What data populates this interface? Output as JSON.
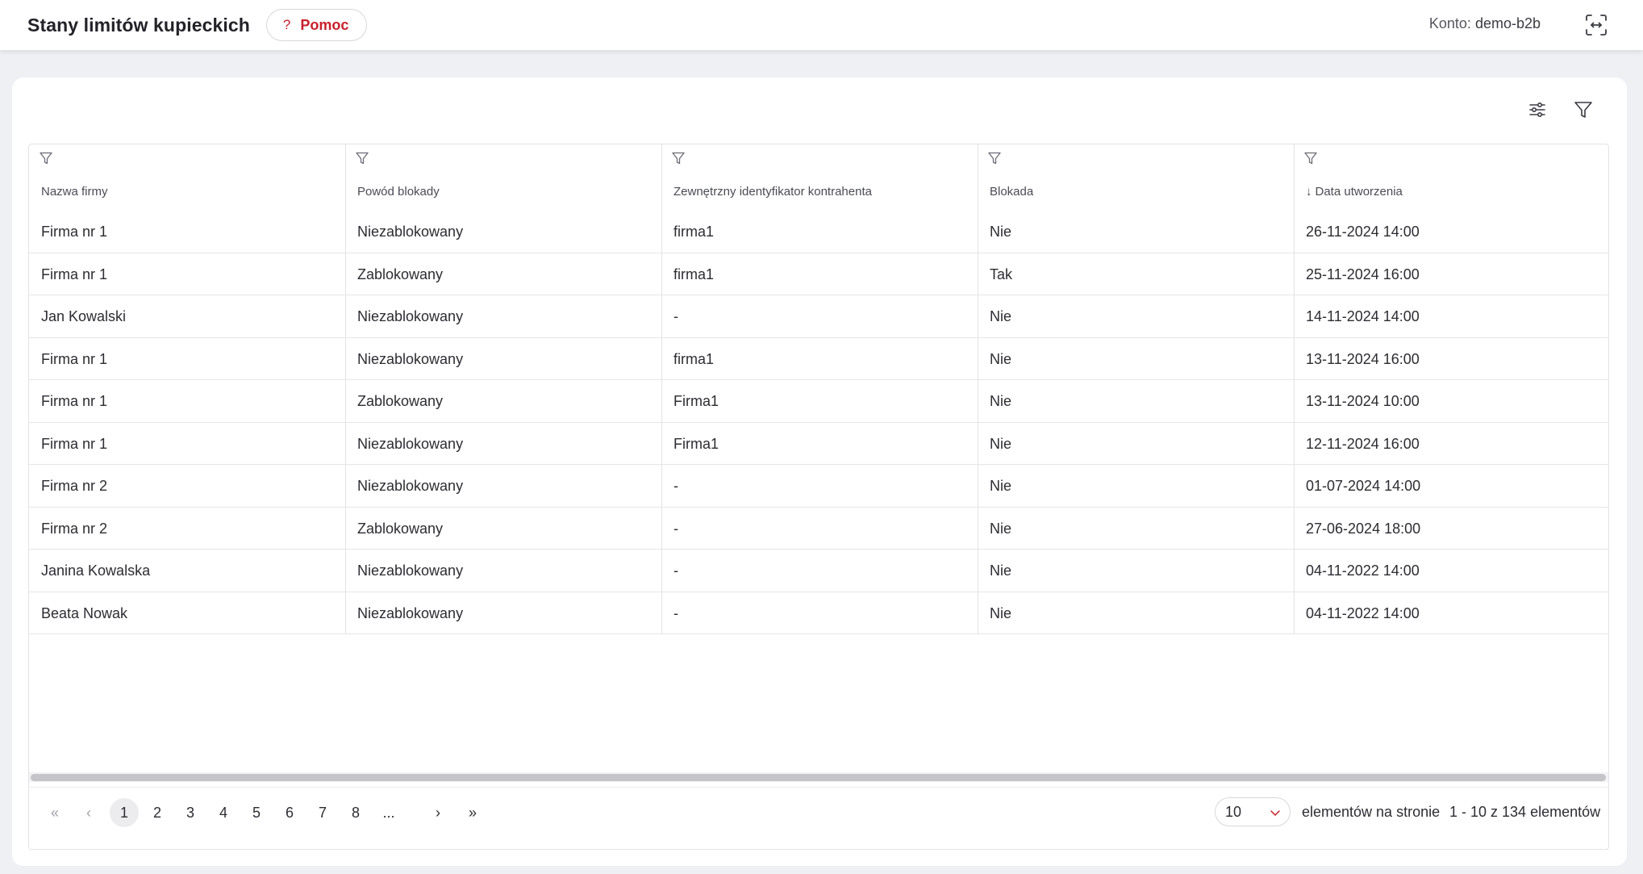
{
  "header": {
    "title": "Stany limitów kupieckich",
    "help_icon": "question-icon",
    "help_label": "Pomoc",
    "account_label": "Konto:",
    "account_value": "demo-b2b",
    "fullscreen_icon": "fullscreen-icon"
  },
  "toolbar": {
    "settings_icon": "sliders-icon",
    "filter_icon": "filter-icon"
  },
  "table": {
    "columns": [
      {
        "label": "Nazwa firmy",
        "sorted": false
      },
      {
        "label": "Powód blokady",
        "sorted": false
      },
      {
        "label": "Zewnętrzny identyfikator kontrahenta",
        "sorted": false
      },
      {
        "label": "Blokada",
        "sorted": false
      },
      {
        "label": "Data utworzenia",
        "sorted": true,
        "sort_direction": "desc",
        "sort_icon": "↓"
      }
    ],
    "rows": [
      [
        "Firma nr 1",
        "Niezablokowany",
        "firma1",
        "Nie",
        "26-11-2024 14:00"
      ],
      [
        "Firma nr 1",
        "Zablokowany",
        "firma1",
        "Tak",
        "25-11-2024 16:00"
      ],
      [
        "Jan Kowalski",
        "Niezablokowany",
        "-",
        "Nie",
        "14-11-2024 14:00"
      ],
      [
        "Firma nr 1",
        "Niezablokowany",
        "firma1",
        "Nie",
        "13-11-2024 16:00"
      ],
      [
        "Firma nr 1",
        "Zablokowany",
        "Firma1",
        "Nie",
        "13-11-2024 10:00"
      ],
      [
        "Firma nr 1",
        "Niezablokowany",
        "Firma1",
        "Nie",
        "12-11-2024 16:00"
      ],
      [
        "Firma nr 2",
        "Niezablokowany",
        "-",
        "Nie",
        "01-07-2024 14:00"
      ],
      [
        "Firma nr 2",
        "Zablokowany",
        "-",
        "Nie",
        "27-06-2024 18:00"
      ],
      [
        "Janina Kowalska",
        "Niezablokowany",
        "-",
        "Nie",
        "04-11-2022 14:00"
      ],
      [
        "Beata Nowak",
        "Niezablokowany",
        "-",
        "Nie",
        "04-11-2022 14:00"
      ]
    ]
  },
  "pagination": {
    "first_icon": "«",
    "prev_icon": "‹",
    "pages": [
      "1",
      "2",
      "3",
      "4",
      "5",
      "6",
      "7",
      "8",
      "..."
    ],
    "current_page": "1",
    "next_icon": "›",
    "last_icon": "»",
    "page_size": "10",
    "page_size_label": "elementów na stronie",
    "range_label": "1 - 10 z 134 elementów"
  },
  "colors": {
    "accent": "#c8202b",
    "background": "#eef0f3",
    "border": "#e3e3e8"
  }
}
